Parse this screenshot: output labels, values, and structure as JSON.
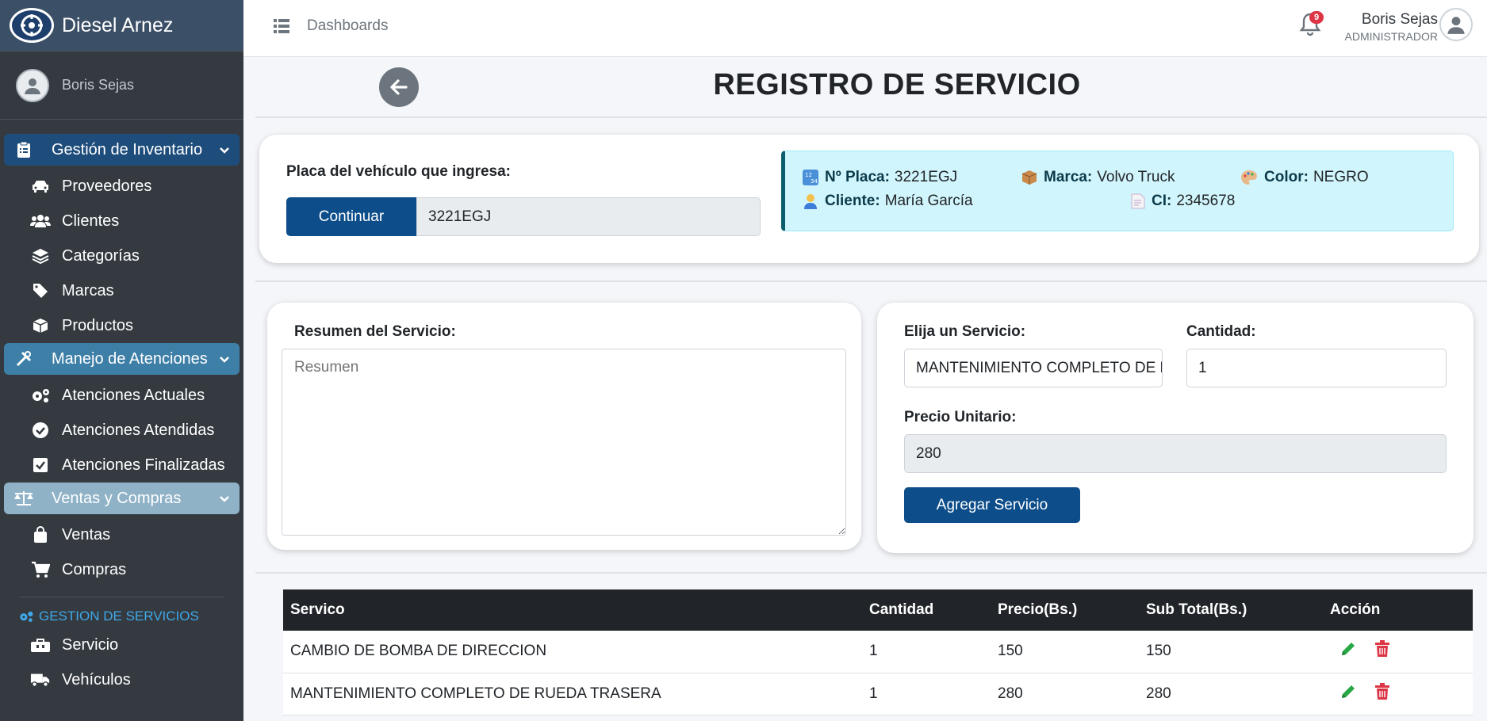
{
  "brand": {
    "name": "Diesel Arnez"
  },
  "sidebar": {
    "user_name": "Boris Sejas",
    "groups": [
      {
        "label": "Gestión de Inventario",
        "items": [
          "Proveedores",
          "Clientes",
          "Categorías",
          "Marcas",
          "Productos"
        ]
      },
      {
        "label": "Manejo de Atenciones",
        "items": [
          "Atenciones Actuales",
          "Atenciones Atendidas",
          "Atenciones Finalizadas"
        ]
      },
      {
        "label": "Ventas y Compras",
        "items": [
          "Ventas",
          "Compras"
        ]
      }
    ],
    "section_title": "GESTION DE SERVICIOS",
    "section_items": [
      "Servicio",
      "Vehículos"
    ]
  },
  "topbar": {
    "dashboards_label": "Dashboards",
    "notification_count": "9",
    "user_name": "Boris Sejas",
    "user_role": "ADMINISTRADOR"
  },
  "page": {
    "title": "REGISTRO DE SERVICIO"
  },
  "vehicle": {
    "label": "Placa del vehículo que ingresa:",
    "continue_label": "Continuar",
    "plate_value": "3221EGJ",
    "info": {
      "plate_label": "Nº Placa:",
      "plate": "3221EGJ",
      "brand_label": "Marca:",
      "brand": "Volvo Truck",
      "color_label": "Color:",
      "color": "NEGRO",
      "client_label": "Cliente:",
      "client": "María García",
      "ci_label": "CI:",
      "ci": "2345678"
    }
  },
  "summary": {
    "label": "Resumen del Servicio:",
    "placeholder": "Resumen"
  },
  "service_form": {
    "service_label": "Elija un Servicio:",
    "service_value": "MANTENIMIENTO COMPLETO DE RUEDA TRASERA",
    "qty_label": "Cantidad:",
    "qty_value": "1",
    "price_label": "Precio Unitario:",
    "price_value": "280",
    "add_label": "Agregar Servicio"
  },
  "table": {
    "headers": [
      "Servico",
      "Cantidad",
      "Precio(Bs.)",
      "Sub Total(Bs.)",
      "Acción"
    ],
    "rows": [
      [
        "CAMBIO DE BOMBA DE DIRECCION",
        "1",
        "150",
        "150"
      ],
      [
        "MANTENIMIENTO COMPLETO DE RUEDA TRASERA",
        "1",
        "280",
        "280"
      ]
    ]
  },
  "colors": {
    "primary": "#0d4d8a",
    "sidebar": "#343a40",
    "danger": "#dc3545",
    "success": "#28a745"
  }
}
